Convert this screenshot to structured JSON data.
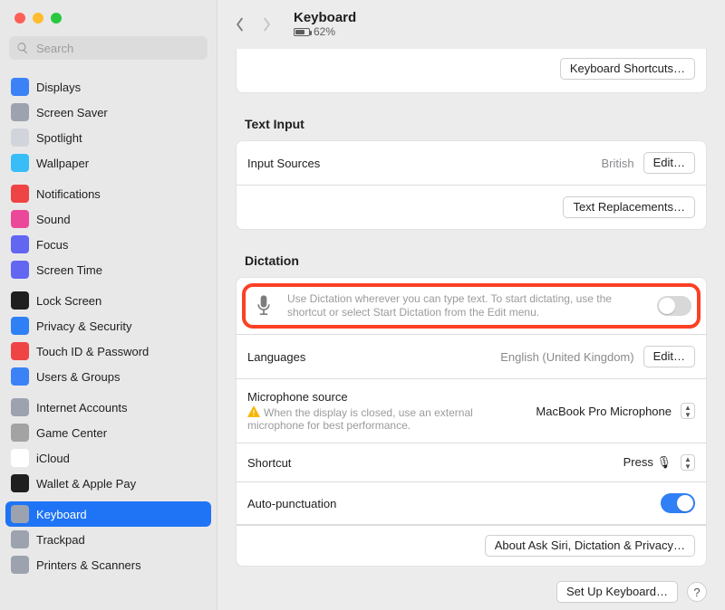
{
  "window": {
    "title": "Keyboard",
    "battery_percent": "62%"
  },
  "traffic_colors": {
    "close": "#ff5f57",
    "min": "#febc2e",
    "max": "#28c840"
  },
  "search": {
    "placeholder": "Search"
  },
  "sidebar": {
    "groups": [
      {
        "items": [
          {
            "label": "Displays",
            "icon_bg": "#3b82f6"
          },
          {
            "label": "Screen Saver",
            "icon_bg": "#9ca3af"
          },
          {
            "label": "Spotlight",
            "icon_bg": "#d1d5db"
          },
          {
            "label": "Wallpaper",
            "icon_bg": "#38bdf8"
          }
        ]
      },
      {
        "items": [
          {
            "label": "Notifications",
            "icon_bg": "#ef4444"
          },
          {
            "label": "Sound",
            "icon_bg": "#ec4899"
          },
          {
            "label": "Focus",
            "icon_bg": "#6366f1"
          },
          {
            "label": "Screen Time",
            "icon_bg": "#6366f1"
          }
        ]
      },
      {
        "items": [
          {
            "label": "Lock Screen",
            "icon_bg": "#1f1f1f"
          },
          {
            "label": "Privacy & Security",
            "icon_bg": "#2f80f6"
          },
          {
            "label": "Touch ID & Password",
            "icon_bg": "#ef4444"
          },
          {
            "label": "Users & Groups",
            "icon_bg": "#3b82f6"
          }
        ]
      },
      {
        "items": [
          {
            "label": "Internet Accounts",
            "icon_bg": "#9ca3af"
          },
          {
            "label": "Game Center",
            "icon_bg": "#a3a3a3"
          },
          {
            "label": "iCloud",
            "icon_bg": "#ffffff"
          },
          {
            "label": "Wallet & Apple Pay",
            "icon_bg": "#1f1f1f"
          }
        ]
      },
      {
        "items": [
          {
            "label": "Keyboard",
            "icon_bg": "#9ca3af",
            "selected": true
          },
          {
            "label": "Trackpad",
            "icon_bg": "#9ca3af"
          },
          {
            "label": "Printers & Scanners",
            "icon_bg": "#9ca3af"
          }
        ]
      }
    ]
  },
  "buttons": {
    "keyboard_shortcuts": "Keyboard Shortcuts…",
    "edit": "Edit…",
    "text_replacements": "Text Replacements…",
    "about_privacy": "About Ask Siri, Dictation & Privacy…",
    "setup": "Set Up Keyboard…"
  },
  "text_input": {
    "title": "Text Input",
    "input_sources_label": "Input Sources",
    "input_sources_value": "British"
  },
  "dictation": {
    "title": "Dictation",
    "description": "Use Dictation wherever you can type text. To start dictating, use the shortcut or select Start Dictation from the Edit menu.",
    "enabled": false,
    "languages_label": "Languages",
    "languages_value": "English (United Kingdom)",
    "mic_label": "Microphone source",
    "mic_value": "MacBook Pro Microphone",
    "mic_warning": "When the display is closed, use an external microphone for best performance.",
    "shortcut_label": "Shortcut",
    "shortcut_value": "Press 🎙",
    "auto_punct_label": "Auto-punctuation",
    "auto_punct_on": true
  }
}
